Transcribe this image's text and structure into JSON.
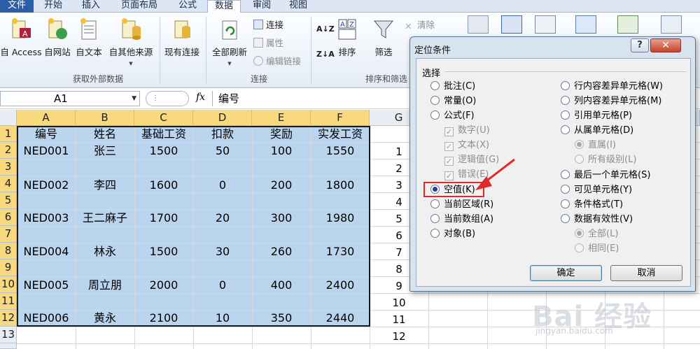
{
  "tabs": [
    "文件",
    "开始",
    "插入",
    "页面布局",
    "公式",
    "数据",
    "审阅",
    "视图"
  ],
  "active_tab": "数据",
  "ribbon": {
    "get_external": {
      "access": "自 Access",
      "web": "自网站",
      "text": "自文本",
      "other": "自其他来源",
      "existing": "现有连接",
      "group_label": "获取外部数据"
    },
    "connections": {
      "refresh_all": "全部刷新",
      "connections": "连接",
      "properties": "属性",
      "edit_links": "编辑链接",
      "group_label": "连接"
    },
    "sort_filter": {
      "sort": "排序",
      "filter": "筛选",
      "clear": "清除",
      "group_label": "排序和筛选"
    }
  },
  "formula_bar": {
    "name_box": "A1",
    "fx": "fx",
    "content": "编号"
  },
  "columns": [
    "A",
    "B",
    "C",
    "D",
    "E",
    "F",
    "G"
  ],
  "rows": [
    "1",
    "2",
    "3",
    "4",
    "5",
    "6",
    "7",
    "8",
    "9",
    "10",
    "11",
    "12",
    "13"
  ],
  "table": {
    "headers": [
      "编号",
      "姓名",
      "基础工资",
      "扣款",
      "奖励",
      "实发工资"
    ],
    "records": [
      [
        "NED001",
        "张三",
        "1500",
        "50",
        "100",
        "1550"
      ],
      [
        "NED002",
        "李四",
        "1600",
        "0",
        "200",
        "1800"
      ],
      [
        "NED003",
        "王二麻子",
        "1700",
        "20",
        "300",
        "1980"
      ],
      [
        "NED004",
        "林永",
        "1500",
        "30",
        "260",
        "1730"
      ],
      [
        "NED005",
        "周立朋",
        "2000",
        "0",
        "400",
        "2400"
      ],
      [
        "NED006",
        "黄永",
        "2100",
        "10",
        "350",
        "2440"
      ]
    ]
  },
  "g_column": [
    "1",
    "2",
    "3",
    "4",
    "5",
    "6",
    "7",
    "8",
    "9",
    "10",
    "11",
    "12"
  ],
  "dialog": {
    "title": "定位条件",
    "help": "?",
    "close": "✕",
    "section": "选择",
    "left_options": [
      {
        "label": "批注(C)",
        "selected": false
      },
      {
        "label": "常量(O)",
        "selected": false
      },
      {
        "label": "公式(F)",
        "selected": false
      }
    ],
    "formula_subs": [
      "数字(U)",
      "文本(X)",
      "逻辑值(G)",
      "错误(E)"
    ],
    "left_options2": [
      {
        "label": "空值(K)",
        "selected": true
      },
      {
        "label": "当前区域(R)",
        "selected": false
      },
      {
        "label": "当前数组(A)",
        "selected": false
      },
      {
        "label": "对象(B)",
        "selected": false
      }
    ],
    "right_options": [
      {
        "label": "行内容差异单元格(W)"
      },
      {
        "label": "列内容差异单元格(M)"
      },
      {
        "label": "引用单元格(P)"
      },
      {
        "label": "从属单元格(D)"
      }
    ],
    "dependents_subs": [
      {
        "label": "直属(I)",
        "selected": true
      },
      {
        "label": "所有级别(L)",
        "selected": false
      }
    ],
    "right_options2": [
      {
        "label": "最后一个单元格(S)"
      },
      {
        "label": "可见单元格(Y)"
      },
      {
        "label": "条件格式(T)"
      },
      {
        "label": "数据有效性(V)"
      }
    ],
    "validation_subs": [
      {
        "label": "全部(L)",
        "selected": true
      },
      {
        "label": "相同(E)",
        "selected": false
      }
    ],
    "ok": "确定",
    "cancel": "取消"
  },
  "watermark": "Bai 经验",
  "watermark_url": "jingyan.baidu.com"
}
